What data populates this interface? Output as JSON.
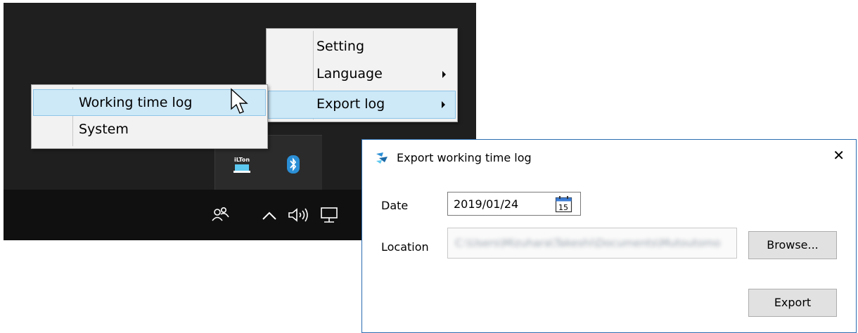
{
  "context_menu": {
    "items": [
      {
        "label": "Setting",
        "has_submenu": false
      },
      {
        "label": "Language",
        "has_submenu": true
      },
      {
        "label": "Export log",
        "has_submenu": true
      }
    ]
  },
  "export_submenu": {
    "items": [
      {
        "label": "Working time log",
        "state": "hover"
      },
      {
        "label": "System"
      }
    ]
  },
  "tray_overflow": {
    "icons": [
      "iltton-app-icon",
      "bluetooth-icon"
    ],
    "app_icon_text": "iLTon"
  },
  "taskbar": {
    "icons": [
      "people-icon",
      "chevron-up-icon",
      "volume-icon",
      "network-icon"
    ]
  },
  "dialog": {
    "title": "Export working time log",
    "date_label": "Date",
    "date_value": "2019/01/24",
    "calendar_day": "15",
    "location_label": "Location",
    "location_value": "C:\\Users\\Mizuhara\\Takeshi\\Documents\\Mutoutomo",
    "browse_label": "Browse...",
    "export_label": "Export",
    "close_glyph": "✕",
    "colors": {
      "border": "#2b6cb0",
      "app_icon": "#2b8fd6"
    }
  }
}
